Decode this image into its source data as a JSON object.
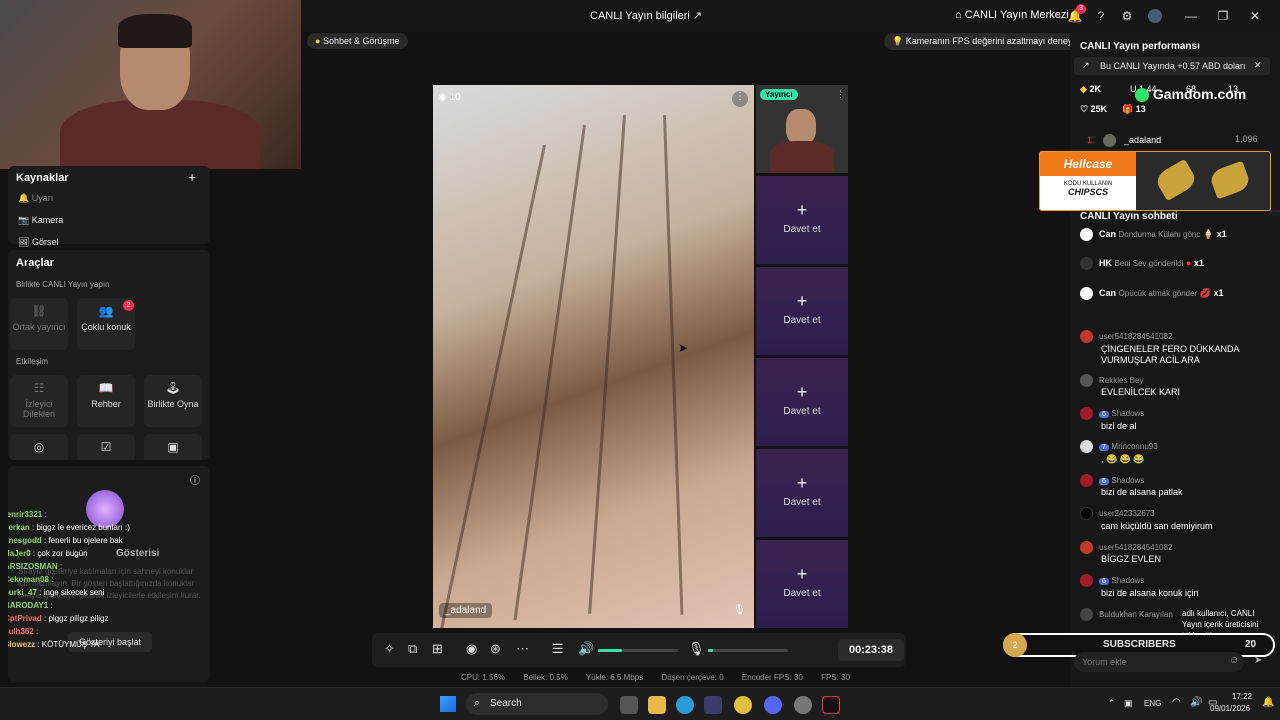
{
  "topbar": {
    "title": "CANLI Yayın bilgileri",
    "center_label": "CANLI Yayın Merkezi",
    "notif_count": "3"
  },
  "stage": {
    "chat_call_label": "Sohbet & Görüşme",
    "fps_tip": "Kameranın FPS değerini azaltmayı deneyin",
    "viewers": "10",
    "guest_name": "_adaland",
    "host_label": "Yayıncı",
    "invite_label": "Davet et"
  },
  "sources": {
    "title": "Kaynaklar",
    "items": [
      "Uyarı",
      "Kamera",
      "Görsel"
    ]
  },
  "tools": {
    "title": "Araçlar",
    "collab_title": "Birlikte CANLI Yayın yapın",
    "co_host": "Ortak yayıncı",
    "multi_guest": "Çoklu konuk",
    "multi_guest_badge": "2",
    "interaction_title": "Etkileşim",
    "viewer_requests": "İzleyici Dilekleri",
    "guide": "Rehber",
    "play_together": "Birlikte Oyna"
  },
  "chat_overlay": {
    "title": "Gösterisi",
    "desc": "Sırayla gösteriye katılmaları için sahneyi konuklar için hazırlayın. Bir gösteri başlattığınızda konuklar sırayla gösteriye çıkarak izleyicilerle etkileşim kurar.",
    "start_button": "Gösteriyi başlat",
    "lines": [
      {
        "user": "fenrir3321",
        "msg": ":"
      },
      {
        "user": "cerkan",
        "msg": ": biggz le evericez bunları :)"
      },
      {
        "user": "enesgodd",
        "msg": ": fenerli bu ojelere bak"
      },
      {
        "user": "HaJer0",
        "msg": ": çok zor bugün"
      },
      {
        "user": "ARSIZOSMAN",
        "msg": ":"
      },
      {
        "user": "Cekoman08",
        "msg": ":"
      },
      {
        "user": "burki_47",
        "msg": ": inge sikecek seni"
      },
      {
        "user": "BARODAY1",
        "msg": ":"
      },
      {
        "user": "CptPrivad",
        "msg": ": piggz piligz piligz"
      },
      {
        "user": "sulh362",
        "msg": ":"
      },
      {
        "user": "Slowezz",
        "msg": ": KÖTÜYMÜŞ YA"
      }
    ]
  },
  "toolbar": {
    "timer": "00:23:38"
  },
  "stats": {
    "cpu": "CPU: 1.56%",
    "mem": "Bellek: 0.5%",
    "upload": "Yükle: 6.5 Mbps",
    "dropped": "Düşen çerçeve: 0",
    "encoder": "Encoder FPS: 30",
    "fps": "FPS: 30"
  },
  "right": {
    "perf_title": "CANLI Yayın performansı",
    "earn_note": "Bu CANLI Yayında +0.57 ABD doları",
    "stat_diamonds": "2K",
    "stat_viewers": "1.44",
    "stat_likes_small": "68",
    "stat_13": "13",
    "stat_likes": "25K",
    "stat_gifts": "13",
    "top_rank": "1",
    "top_user": "_adaland",
    "top_score": "1,096",
    "chat_title": "CANLI Yayın sohbeti",
    "gifts": [
      {
        "user": "Can",
        "text": "Dondurma Külahı gönc",
        "count": "x1"
      },
      {
        "user": "HK",
        "text": "Beni Sev gönderildi",
        "count": "x1"
      },
      {
        "user": "Can",
        "text": "Öpücük atmak gönder",
        "count": "x1"
      }
    ],
    "messages": [
      {
        "user": "user5418284541082",
        "text": "ÇİNGENELER FERO DÜKKANDA VURMUŞLAR ACİL ARA"
      },
      {
        "user": "Rekkles Bey",
        "text": "EVLENİLCEK KARI"
      },
      {
        "user": "Shadows",
        "badge": "6",
        "text": "bizi de al"
      },
      {
        "user": "Mrinconnu93",
        "badge": "7",
        "text": ", 😂 😂 😂"
      },
      {
        "user": "Shadows",
        "badge": "6",
        "text": "bizi de alsana patlak"
      },
      {
        "user": "user242332673",
        "text": "cam küçüldü san demiyirum"
      },
      {
        "user": "user5418284541082",
        "text": "BİGGZ EVLEN"
      },
      {
        "user": "Shadows",
        "badge": "6",
        "text": "bizi de alsana konuk için"
      },
      {
        "user": "Buldukhan Karayılan",
        "text": "adlı kullanıcı, CANLI Yayın içerik üreticisini takip etti"
      }
    ],
    "input_placeholder": "Yorum ekle"
  },
  "overlays": {
    "gamdom": "Gamdom.com",
    "hellcase_brand": "Hellcase",
    "hellcase_code_label": "KODU KULLANIN",
    "hellcase_code": "CHIPSCS",
    "subs_label": "SUBSCRIBERS",
    "subs_left": "2",
    "subs_right": "20"
  },
  "taskbar": {
    "search": "Search",
    "lang": "ENG",
    "time": "17:22",
    "date": "09/01/2026"
  },
  "colors": {
    "accent_pink": "#fe2c55",
    "invite_purple": "#3b2250",
    "mic_green": "#2ee6a8"
  }
}
